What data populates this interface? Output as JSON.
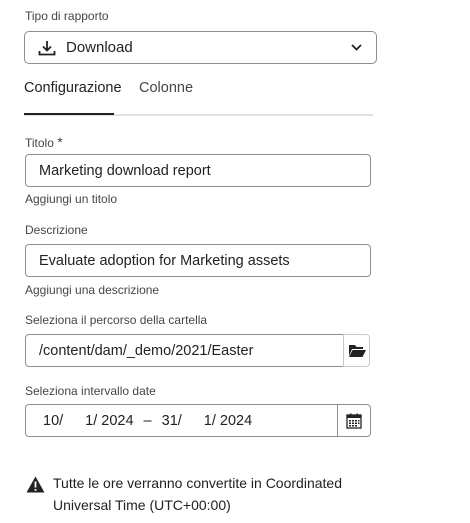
{
  "report_type": {
    "label": "Tipo di rapporto",
    "value": "Download",
    "icon": "download-icon"
  },
  "tabs": [
    {
      "label": "Configurazione",
      "active": true
    },
    {
      "label": "Colonne",
      "active": false
    }
  ],
  "title_field": {
    "label": "Titolo",
    "required_mark": "*",
    "value": "Marketing download report",
    "helper": "Aggiungi un titolo"
  },
  "description_field": {
    "label": "Descrizione",
    "value": "Evaluate adoption for Marketing assets",
    "helper": "Aggiungi una descrizione"
  },
  "folder_field": {
    "label": "Seleziona il percorso della cartella",
    "value": "/content/dam/_demo/2021/Easter",
    "icon": "folder-open-icon"
  },
  "date_range": {
    "label": "Seleziona intervallo date",
    "start": {
      "day": "10",
      "month": "1",
      "year": "2024"
    },
    "end": {
      "day": "31",
      "month": "1",
      "year": "2024"
    },
    "separator": "–",
    "slash": "/",
    "icon": "calendar-icon"
  },
  "notice": {
    "line1": "Tutte le ore verranno convertite in Coordinated",
    "line2": "Universal Time (UTC+00:00)",
    "icon": "warning-icon"
  }
}
